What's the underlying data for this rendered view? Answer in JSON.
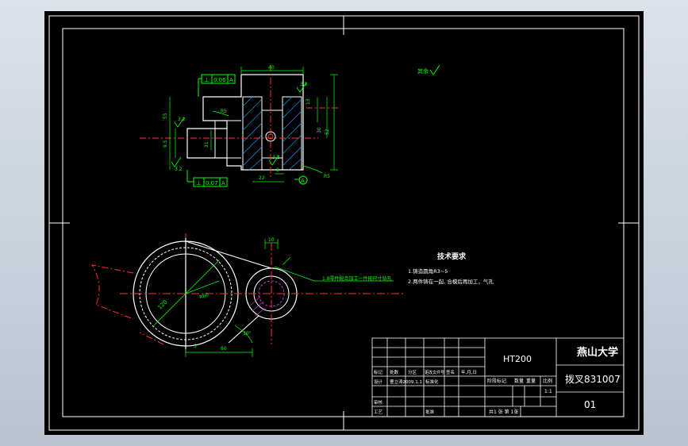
{
  "drawing": {
    "roughness_symbol": "其余",
    "tech_req": {
      "title": "技术要求",
      "items": [
        "1.铸造圆角R3~5",
        "2.两件铸在一起, 合模后再加工，气孔"
      ]
    },
    "leader_note": "1.8零件配合加工一件按尺寸钻孔",
    "gdt": [
      {
        "symbol": "⊥",
        "value": "0.06",
        "datum": "A"
      },
      {
        "symbol": "⊥",
        "value": "0.07",
        "datum": "A"
      }
    ],
    "datum_label": "A",
    "dims": {
      "top_width": "40",
      "h_right_1": "13",
      "h_right_2": "30",
      "h_right_3": "52",
      "left_55": "55",
      "left_small": "9.5",
      "dia_31": "31",
      "bottom_22": "22",
      "bottom_small": "8",
      "r5_a": "R5",
      "r5_b": "R5",
      "ra_1": "3.2",
      "ra_2": "3.2",
      "ra_3": "3.2",
      "ra_4": "3.2",
      "plan_top": "10",
      "plan_dia": "120",
      "plan_r": "R60",
      "plan_bottom": "60",
      "plan_angle": "30°",
      "plan_small": "5"
    }
  },
  "title_block": {
    "material": "HT200",
    "school": "燕山大学",
    "part_name": "拨叉831007",
    "drawing_no": "01",
    "scale_label": "比例",
    "scale_value": "1:1",
    "weight_label": "重量",
    "count_label": "数量",
    "stage_label": "阶段标记",
    "sheet_text": "共1  张  第  1张",
    "row_headers": [
      "标记",
      "处数",
      "分区",
      "更改文件号",
      "签名",
      "年,月,日"
    ],
    "designer_label": "设计",
    "designer_value": "曹立涛2009.1.1",
    "standard_label": "标准化",
    "review_label": "审核",
    "process_label": "工艺",
    "approve_label": "批准"
  }
}
